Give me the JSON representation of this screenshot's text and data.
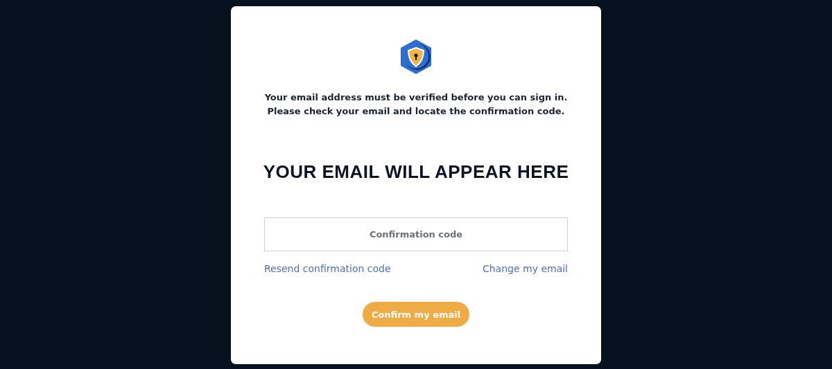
{
  "message": [
    "Your email address must be verified before you can sign in.",
    "Please check your email and locate the confirmation code."
  ],
  "email_heading": "YOUR EMAIL WILL APPEAR HERE",
  "code_field": {
    "placeholder": "Confirmation code"
  },
  "links": [
    "Resend confirmation code",
    "Change my email"
  ],
  "confirm_button": "Confirm my email"
}
